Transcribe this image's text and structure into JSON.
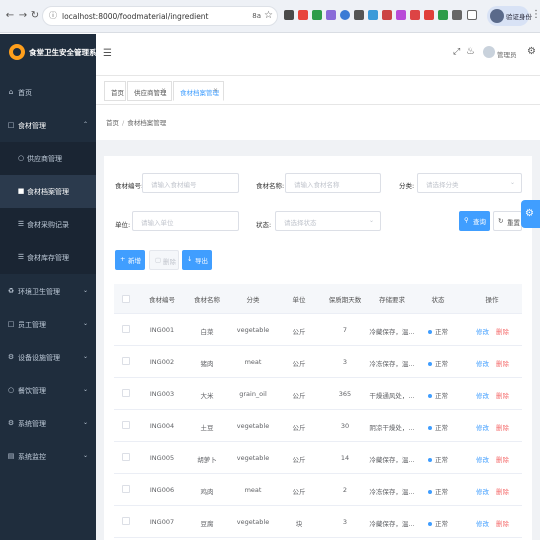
{
  "browser": {
    "url": "localhost:8000/foodmaterial/ingredient",
    "zoom_label": "8а",
    "profile_label": "验证身份"
  },
  "app": {
    "title": "食堂卫生安全管理系统",
    "user_name": "管理员"
  },
  "sidebar": {
    "items": [
      {
        "label": "首页",
        "icon": "home-icon"
      },
      {
        "label": "食材管理",
        "icon": "bag-icon",
        "expanded": true
      },
      {
        "label": "环境卫生管理",
        "icon": "recycle-icon"
      },
      {
        "label": "员工管理",
        "icon": "user-icon"
      },
      {
        "label": "设备设施管理",
        "icon": "device-icon"
      },
      {
        "label": "餐饮管理",
        "icon": "food-icon"
      },
      {
        "label": "系统管理",
        "icon": "gear-icon"
      },
      {
        "label": "系统监控",
        "icon": "monitor-icon"
      }
    ],
    "sub_items": [
      {
        "label": "供应商管理",
        "icon": "person-icon"
      },
      {
        "label": "食材档案管理",
        "icon": "file-icon",
        "active": true
      },
      {
        "label": "食材采购记录",
        "icon": "cart-icon"
      },
      {
        "label": "食材库存管理",
        "icon": "list-icon"
      }
    ]
  },
  "tabs": [
    {
      "label": "首页",
      "closable": false
    },
    {
      "label": "供应商管理",
      "closable": true
    },
    {
      "label": "食材档案管理",
      "closable": true,
      "active": true
    }
  ],
  "breadcrumb": [
    "首页",
    "食材档案管理"
  ],
  "filters": {
    "code_label": "食材编号:",
    "code_placeholder": "请输入食材编号",
    "name_label": "食材名称:",
    "name_placeholder": "请输入食材名称",
    "category_label": "分类:",
    "category_placeholder": "请选择分类",
    "unit_label": "单位:",
    "unit_placeholder": "请输入单位",
    "status_label": "状态:",
    "status_placeholder": "请选择状态",
    "search_label": "查询",
    "reset_label": "重置"
  },
  "toolbar": {
    "add_label": "新增",
    "delete_label": "删除",
    "export_label": "导出"
  },
  "table": {
    "columns": [
      "食材编号",
      "食材名称",
      "分类",
      "单位",
      "保质期天数",
      "存储要求",
      "状态",
      "操作"
    ],
    "edit_label": "修改",
    "delete_label": "删除",
    "rows": [
      {
        "code": "ING001",
        "name": "白菜",
        "category": "vegetable",
        "unit": "公斤",
        "shelf_days": "7",
        "storage": "冷藏保存，温...",
        "status": "正常"
      },
      {
        "code": "ING002",
        "name": "猪肉",
        "category": "meat",
        "unit": "公斤",
        "shelf_days": "3",
        "storage": "冷冻保存，温...",
        "status": "正常"
      },
      {
        "code": "ING003",
        "name": "大米",
        "category": "grain_oil",
        "unit": "公斤",
        "shelf_days": "365",
        "storage": "干燥通风处，...",
        "status": "正常"
      },
      {
        "code": "ING004",
        "name": "土豆",
        "category": "vegetable",
        "unit": "公斤",
        "shelf_days": "30",
        "storage": "阴凉干燥处，...",
        "status": "正常"
      },
      {
        "code": "ING005",
        "name": "胡萝卜",
        "category": "vegetable",
        "unit": "公斤",
        "shelf_days": "14",
        "storage": "冷藏保存，温...",
        "status": "正常"
      },
      {
        "code": "ING006",
        "name": "鸡肉",
        "category": "meat",
        "unit": "公斤",
        "shelf_days": "2",
        "storage": "冷冻保存，温...",
        "status": "正常"
      },
      {
        "code": "ING007",
        "name": "豆腐",
        "category": "vegetable",
        "unit": "块",
        "shelf_days": "3",
        "storage": "冷藏保存，温...",
        "status": "正常"
      }
    ]
  }
}
